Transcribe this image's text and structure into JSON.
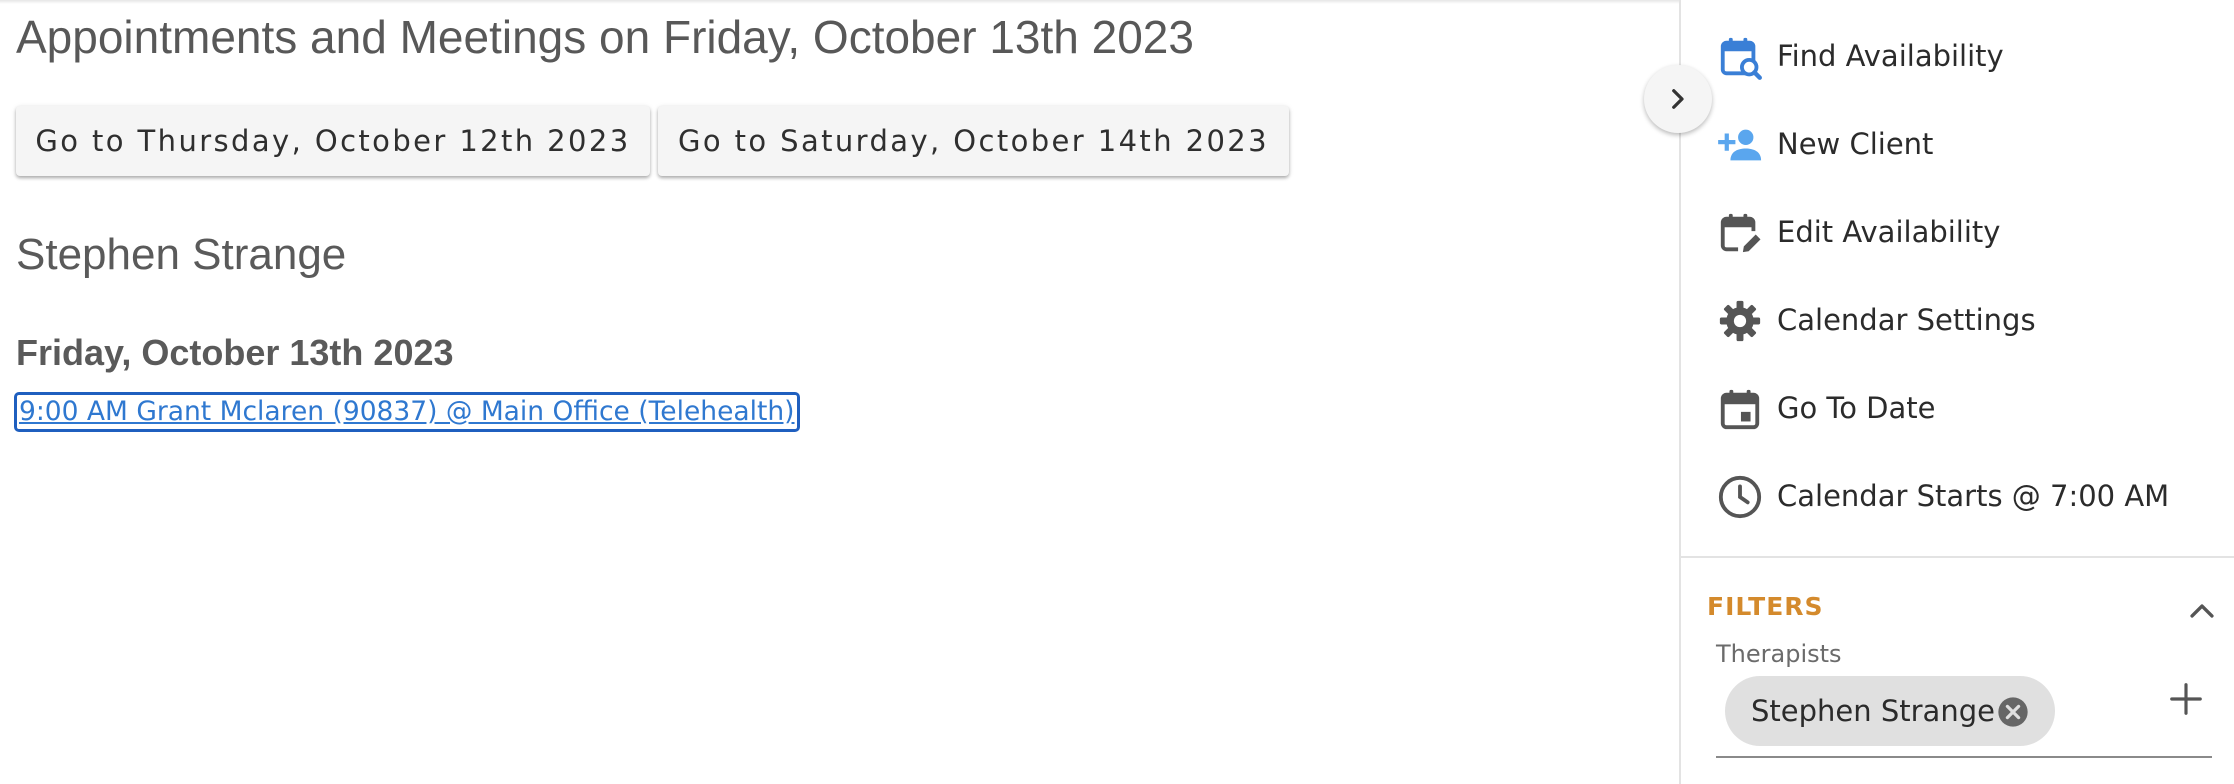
{
  "main": {
    "title": "Appointments and Meetings on Friday, October 13th 2023",
    "prev_day_button": "Go to Thursday, October 12th 2023",
    "next_day_button": "Go to Saturday, October 14th 2023",
    "therapist": "Stephen Strange",
    "day_heading": "Friday, October 13th 2023",
    "appointments": [
      {
        "label": "9:00 AM Grant Mclaren (90837) @ Main Office (Telehealth)"
      }
    ]
  },
  "sidebar": {
    "collapse_icon": "chevron-right-icon",
    "menu": [
      {
        "label": "Find Availability",
        "icon": "calendar-search-icon"
      },
      {
        "label": "New Client",
        "icon": "person-add-icon"
      },
      {
        "label": "Edit Availability",
        "icon": "calendar-edit-icon"
      },
      {
        "label": "Calendar Settings",
        "icon": "gear-icon"
      },
      {
        "label": "Go To Date",
        "icon": "calendar-event-icon"
      },
      {
        "label": "Calendar Starts @ 7:00 AM",
        "icon": "clock-icon"
      }
    ],
    "filters": {
      "title": "FILTERS",
      "expanded": true,
      "therapists_label": "Therapists",
      "selected_therapists": [
        "Stephen Strange"
      ]
    }
  },
  "colors": {
    "accent_blue": "#2f78d0",
    "icon_blue": "#3a7fd6",
    "icon_light_blue": "#5aa6ee",
    "icon_gray": "#555555",
    "filters_orange": "#d48a2c",
    "chip_bg": "#e0e0e0"
  }
}
